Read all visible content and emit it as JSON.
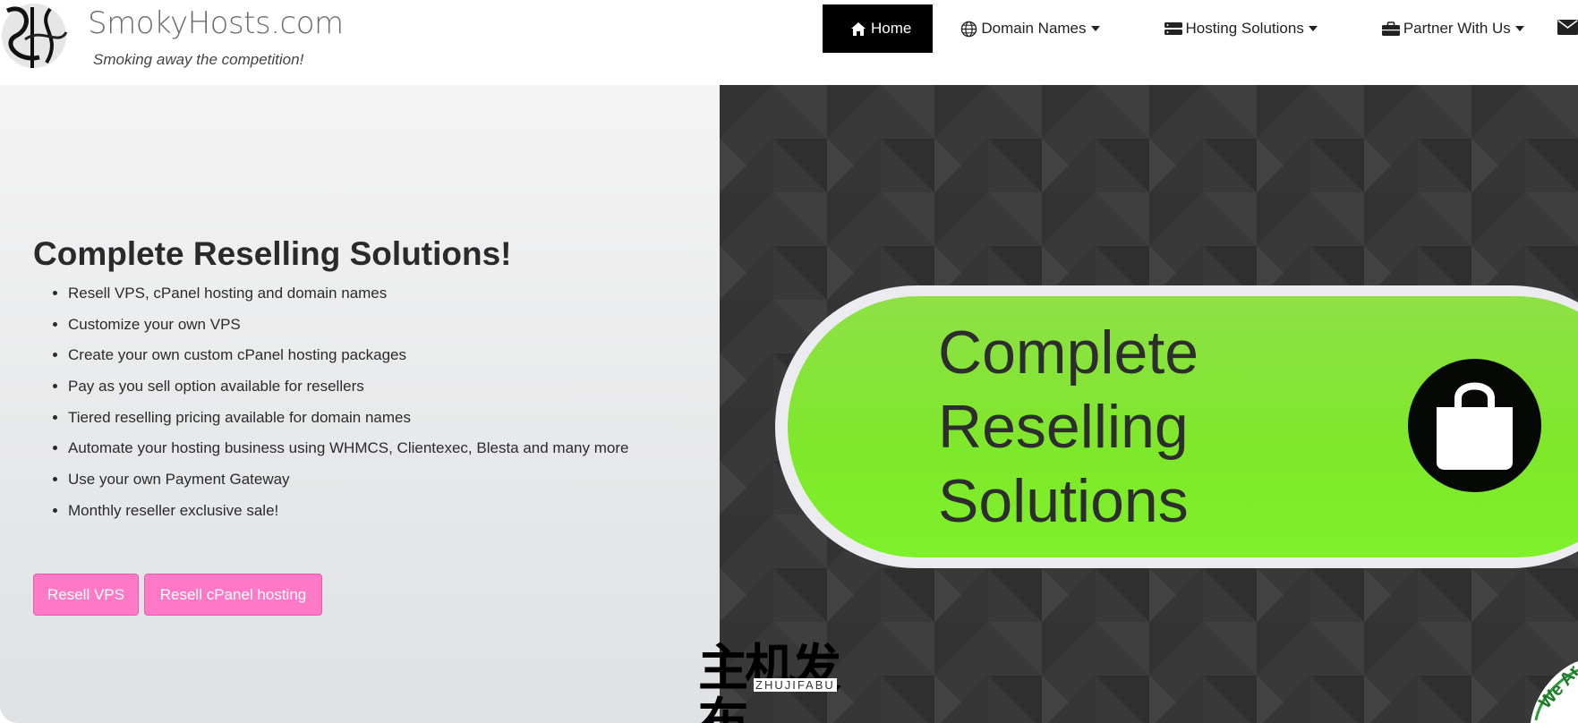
{
  "brand": {
    "name": "SmokyHosts.com",
    "tagline": "Smoking away the competition!",
    "logo_icon": "sh-monogram-logo"
  },
  "nav": {
    "items": [
      {
        "label": "Home",
        "icon": "home-icon",
        "active": true
      },
      {
        "label": "Domain Names",
        "icon": "globe-icon",
        "dropdown": true
      },
      {
        "label": "Hosting Solutions",
        "icon": "server-icon",
        "dropdown": true
      },
      {
        "label": "Partner With Us",
        "icon": "briefcase-icon",
        "dropdown": true
      }
    ],
    "extra_icon": "envelope-icon"
  },
  "hero": {
    "title": "Complete Reselling Solutions!",
    "features": [
      "Resell VPS, cPanel hosting and domain names",
      "Customize your own VPS",
      "Create your own custom cPanel hosting packages",
      "Pay as you sell option available for resellers",
      "Tiered reselling pricing available for domain names",
      "Automate your hosting business using WHMCS, Clientexec, Blesta and many more",
      "Use your own Payment Gateway",
      "Monthly reseller exclusive sale!"
    ],
    "buttons": {
      "resell_vps": "Resell VPS",
      "resell_cpanel": "Resell cPanel hosting"
    },
    "banner": {
      "line1": "Complete",
      "line2": "Reselling",
      "line3": "Solutions",
      "icon": "shopping-bag-icon"
    }
  },
  "watermark": {
    "cn": "主机发布",
    "en": "ZHUJIFABU"
  },
  "corner_badge": "We Ar",
  "colors": {
    "accent_pink": "#ff79c6",
    "nav_active_bg": "#000000",
    "banner_green": "#7ee82a",
    "dark_panel": "#3a3a3a"
  }
}
